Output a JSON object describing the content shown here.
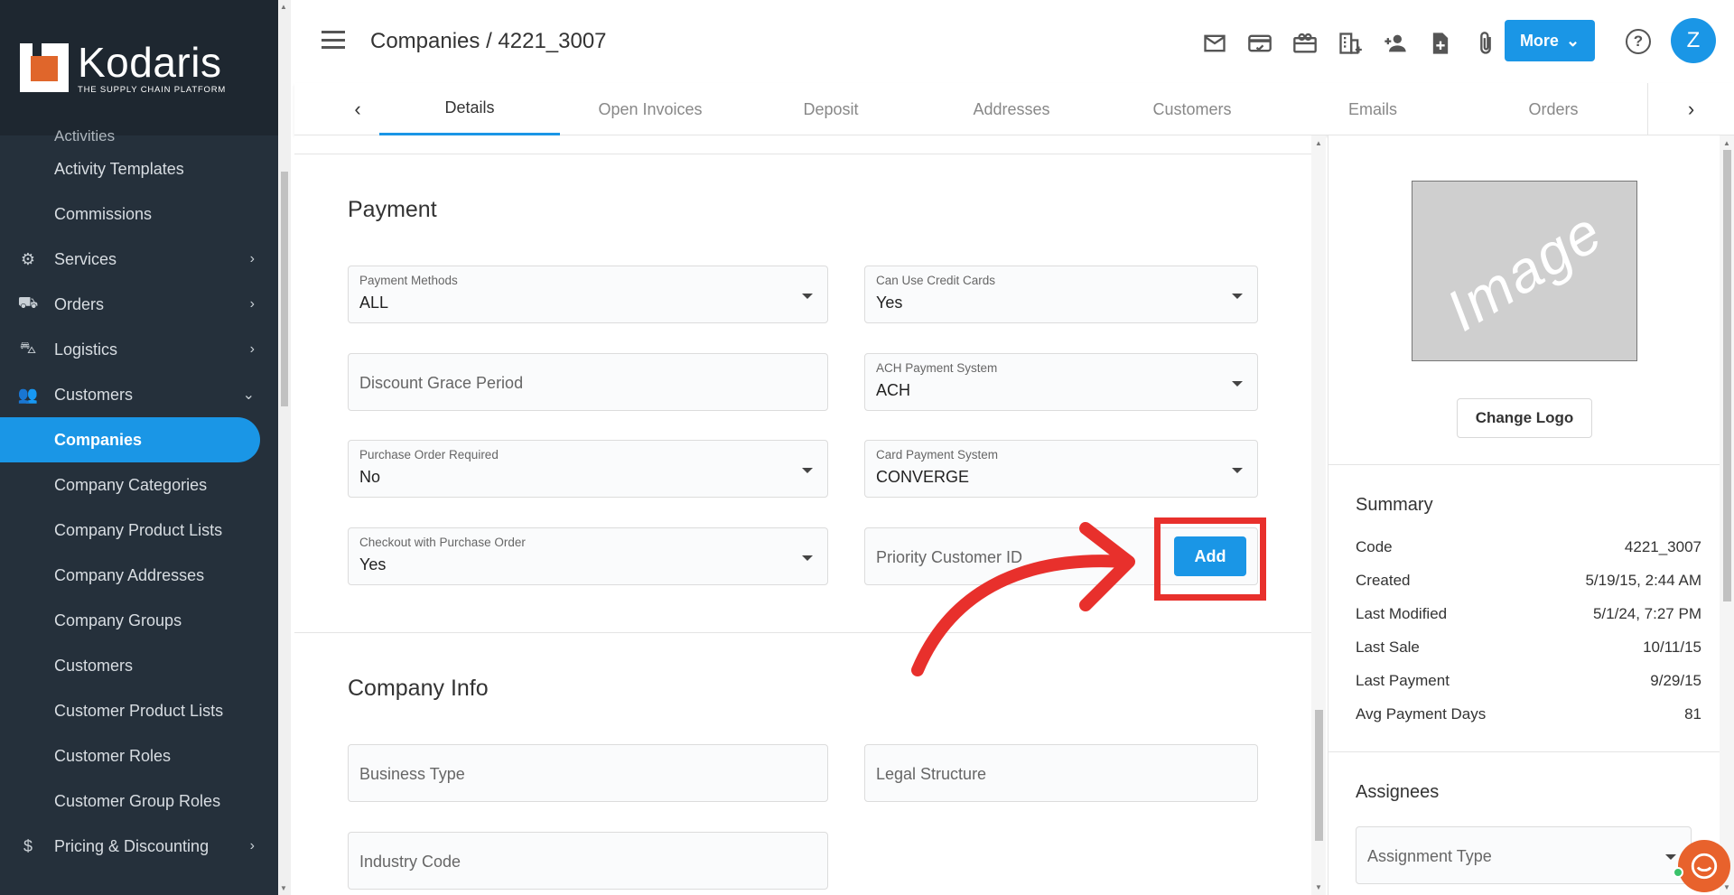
{
  "brand": {
    "name": "Kodaris",
    "tagline": "THE SUPPLY CHAIN PLATFORM"
  },
  "sidebar": {
    "items": [
      {
        "label": "Activities",
        "type": "partial"
      },
      {
        "label": "Activity Templates",
        "type": "sub"
      },
      {
        "label": "Commissions",
        "type": "sub"
      },
      {
        "label": "Services",
        "type": "parent",
        "icon": "gears-icon",
        "chevron": "›"
      },
      {
        "label": "Orders",
        "type": "parent",
        "icon": "truck-icon",
        "chevron": "›"
      },
      {
        "label": "Logistics",
        "type": "parent",
        "icon": "shipping-icon",
        "chevron": "›"
      },
      {
        "label": "Customers",
        "type": "parent",
        "icon": "people-icon",
        "chevron": "⌄"
      },
      {
        "label": "Companies",
        "type": "sub",
        "active": true
      },
      {
        "label": "Company Categories",
        "type": "sub"
      },
      {
        "label": "Company Product Lists",
        "type": "sub"
      },
      {
        "label": "Company Addresses",
        "type": "sub"
      },
      {
        "label": "Company Groups",
        "type": "sub"
      },
      {
        "label": "Customers",
        "type": "sub"
      },
      {
        "label": "Customer Product Lists",
        "type": "sub"
      },
      {
        "label": "Customer Roles",
        "type": "sub"
      },
      {
        "label": "Customer Group Roles",
        "type": "sub"
      },
      {
        "label": "Pricing & Discounting",
        "type": "parent",
        "icon": "dollar-icon",
        "chevron": "›"
      }
    ]
  },
  "header": {
    "title": "Companies / 4221_3007",
    "more_label": "More",
    "avatar_initial": "Z",
    "help_glyph": "?",
    "icons": [
      "mail-icon",
      "credit-card-icon",
      "gift-card-icon",
      "building-add-icon",
      "add-person-icon",
      "add-document-icon",
      "attachment-icon"
    ]
  },
  "tabs": {
    "prev_glyph": "‹",
    "next_glyph": "›",
    "items": [
      "Details",
      "Open Invoices",
      "Deposit",
      "Addresses",
      "Customers",
      "Emails",
      "Orders"
    ],
    "active": "Details"
  },
  "payment": {
    "title": "Payment",
    "payment_methods": {
      "label": "Payment Methods",
      "value": "ALL"
    },
    "can_use_credit_cards": {
      "label": "Can Use Credit Cards",
      "value": "Yes"
    },
    "discount_grace_period": {
      "placeholder": "Discount Grace Period"
    },
    "ach_payment_system": {
      "label": "ACH Payment System",
      "value": "ACH"
    },
    "purchase_order_required": {
      "label": "Purchase Order Required",
      "value": "No"
    },
    "card_payment_system": {
      "label": "Card Payment System",
      "value": "CONVERGE"
    },
    "checkout_with_po": {
      "label": "Checkout with Purchase Order",
      "value": "Yes"
    },
    "priority_customer_id": {
      "placeholder": "Priority Customer ID"
    },
    "add_label": "Add"
  },
  "company_info": {
    "title": "Company Info",
    "business_type": {
      "placeholder": "Business Type"
    },
    "legal_structure": {
      "placeholder": "Legal Structure"
    },
    "industry_code": {
      "placeholder": "Industry Code"
    }
  },
  "right_panel": {
    "image_placeholder": "Image",
    "change_logo_label": "Change Logo",
    "summary_title": "Summary",
    "summary": [
      {
        "key": "Code",
        "value": "4221_3007"
      },
      {
        "key": "Created",
        "value": "5/19/15, 2:44 AM"
      },
      {
        "key": "Last Modified",
        "value": "5/1/24, 7:27 PM"
      },
      {
        "key": "Last Sale",
        "value": "10/11/15"
      },
      {
        "key": "Last Payment",
        "value": "9/29/15"
      },
      {
        "key": "Avg Payment Days",
        "value": "81"
      }
    ],
    "assignees_title": "Assignees",
    "assignment_type_placeholder": "Assignment Type"
  },
  "colors": {
    "accent": "#1a96e6",
    "sidebar_bg": "#25303b",
    "highlight": "#e8302c",
    "brand_orange": "#e0662b"
  }
}
